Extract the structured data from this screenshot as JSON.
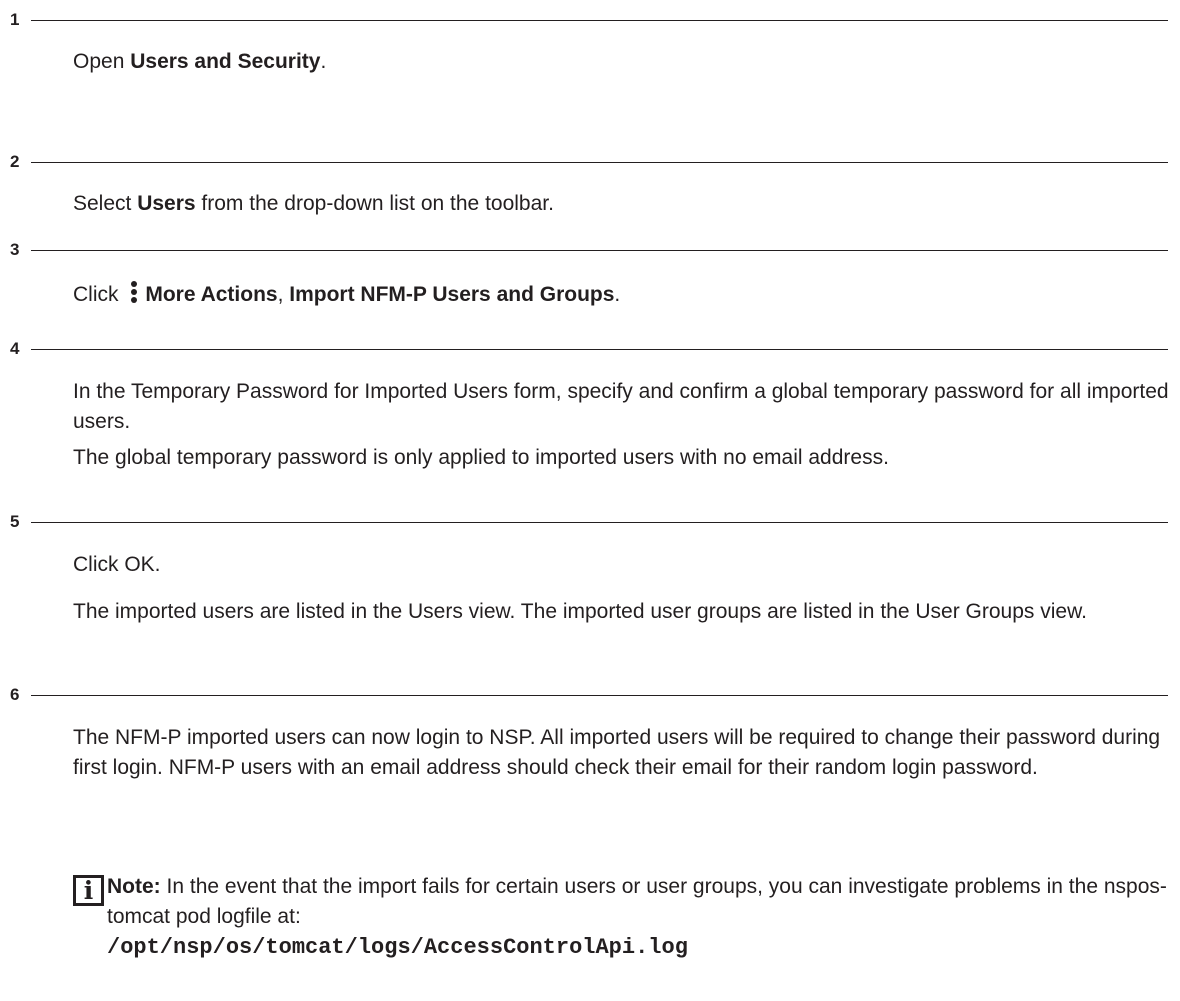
{
  "steps": [
    {
      "number": "1",
      "parts": [
        {
          "text": "Open "
        },
        {
          "text": "Users and Security",
          "bold": true
        },
        {
          "text": "."
        }
      ]
    },
    {
      "number": "2",
      "parts": [
        {
          "text": "Select "
        },
        {
          "text": "Users",
          "bold": true
        },
        {
          "text": " from the drop-down list on the toolbar."
        }
      ]
    },
    {
      "number": "3",
      "parts": [
        {
          "text": "Click "
        },
        {
          "text": "More Actions",
          "bold": true
        },
        {
          "text": ", "
        },
        {
          "text": "Import NFM-P Users and Groups",
          "bold": true
        },
        {
          "text": "."
        }
      ],
      "icon": "more-actions-kebab-icon"
    },
    {
      "number": "4",
      "paragraphs": [
        "In the Temporary Password for Imported Users form, specify and confirm a global temporary password for all imported users.",
        "The global temporary password is only applied to imported users with no email address."
      ]
    },
    {
      "number": "5",
      "paragraphs": [
        "Click OK.",
        "The imported users are listed in the Users view. The imported user groups are listed in the User Groups view."
      ]
    },
    {
      "number": "6",
      "paragraphs": [
        "The NFM-P imported users can now login to NSP. All imported users will be required to change their password during first login. NFM-P users with an email address should check their email for their random login password."
      ]
    }
  ],
  "note": {
    "icon": "info-icon",
    "label": "Note:",
    "text": "In the event that the import fails for certain users or user groups, you can investigate problems in the nspos-tomcat pod logfile at:",
    "path": "/opt/nsp/os/tomcat/logs/AccessControlApi.log"
  }
}
